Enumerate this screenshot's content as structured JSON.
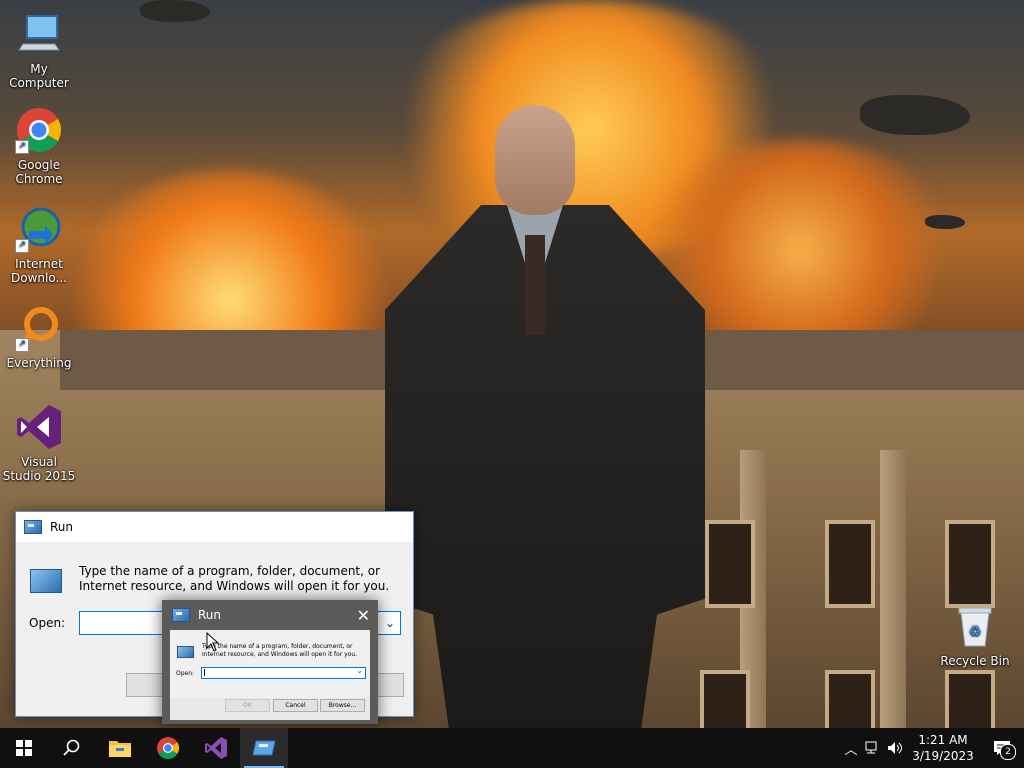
{
  "desktop": {
    "icons": [
      {
        "label": "My Computer"
      },
      {
        "label": "Google Chrome"
      },
      {
        "label": "Internet Downlo..."
      },
      {
        "label": "Everything"
      },
      {
        "label": "Visual Studio 2015"
      },
      {
        "label": "Recycle Bin"
      }
    ]
  },
  "run_dialog_main": {
    "title": "Run",
    "description": "Type the name of a program, folder, document, or Internet resource, and Windows will open it for you.",
    "open_label": "Open:",
    "open_value": ""
  },
  "run_dialog_small": {
    "title": "Run",
    "description": "Type the name of a program, folder, document, or Internet resource, and Windows will open it for you.",
    "open_label": "Open:",
    "open_value": "",
    "ok_label": "OK",
    "cancel_label": "Cancel",
    "browse_label": "Browse..."
  },
  "taskbar": {
    "apps": [
      {
        "icon": "windows-start-icon"
      },
      {
        "icon": "search-icon"
      },
      {
        "icon": "file-explorer-icon"
      },
      {
        "icon": "chrome-icon"
      },
      {
        "icon": "visual-studio-icon"
      },
      {
        "icon": "run-icon"
      }
    ],
    "time": "1:21 AM",
    "date": "3/19/2023",
    "notification_count": "2"
  },
  "colors": {
    "taskbar": "#101010",
    "accent": "#0078d7"
  }
}
